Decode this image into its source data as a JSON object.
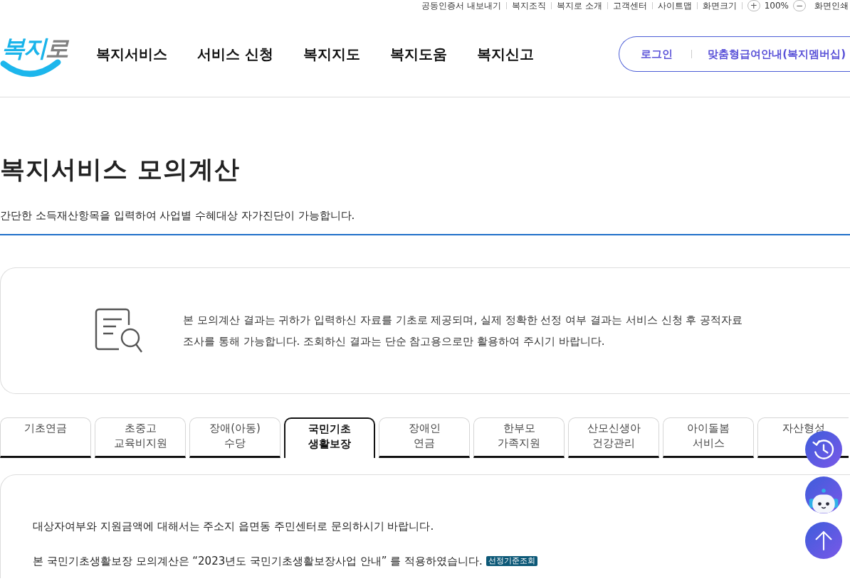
{
  "utility_bar": {
    "links": [
      "공동인증서 내보내기",
      "복지조직",
      "복지로 소개",
      "고객센터",
      "사이트맵"
    ],
    "zoom": {
      "label": "화면크기",
      "increase": "+",
      "value": "100%",
      "decrease": "−"
    },
    "print": "화면인쇄"
  },
  "header": {
    "logo": "복지로",
    "nav": [
      "복지서비스",
      "서비스 신청",
      "복지지도",
      "복지도움",
      "복지신고"
    ],
    "account_links": [
      "로그인",
      "맞춤형급여안내(복지멤버십)"
    ]
  },
  "page": {
    "title": "복지서비스 모의계산",
    "subtitle": "간단한 소득재산항목을 입력하여 사업별 수혜대상 자가진단이 가능합니다."
  },
  "notice": {
    "text": "본 모의계산 결과는 귀하가 입력하신 자료를 기초로 제공되며, 실제 정확한 선정 여부 결과는 서비스 신청 후 공적자료 조사를 통해 가능합니다. 조회하신 결과는 단순 참고용으로만 활용하여 주시기 바랍니다."
  },
  "tabs": [
    {
      "label": "기초연금",
      "selected": false
    },
    {
      "label": "초중고\n교육비지원",
      "selected": false
    },
    {
      "label": "장애(아동)\n수당",
      "selected": false
    },
    {
      "label": "국민기초\n생활보장",
      "selected": true
    },
    {
      "label": "장애인\n연금",
      "selected": false
    },
    {
      "label": "한부모\n가족지원",
      "selected": false
    },
    {
      "label": "산모신생아\n건강관리",
      "selected": false
    },
    {
      "label": "아이돌봄\n서비스",
      "selected": false
    },
    {
      "label": "자산형성",
      "selected": false
    }
  ],
  "content": {
    "paragraphs": [
      {
        "text": "대상자여부와 지원금액에 대해서는 주소지 읍면동 주민센터로 문의하시기 바랍니다."
      },
      {
        "text": "본 국민기초생활보장 모의계산은 “2023년도 국민기초생활보장사업 안내” 를 적용하였습니다.",
        "link": "선정기준조회"
      }
    ]
  }
}
